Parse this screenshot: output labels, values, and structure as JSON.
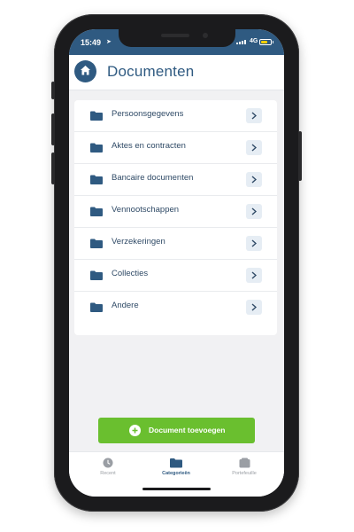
{
  "status_bar": {
    "time": "15:49",
    "location_glyph": "➤",
    "network": "4G"
  },
  "header": {
    "title": "Documenten"
  },
  "categories": [
    {
      "label": "Persoonsgegevens"
    },
    {
      "label": "Aktes en contracten"
    },
    {
      "label": "Bancaire documenten"
    },
    {
      "label": "Vennootschappen"
    },
    {
      "label": "Verzekeringen"
    },
    {
      "label": "Collecties"
    },
    {
      "label": "Andere"
    }
  ],
  "add_button": {
    "label": "Document toevoegen"
  },
  "tabs": [
    {
      "label": "Recent",
      "icon": "clock-icon",
      "active": false
    },
    {
      "label": "Categorieën",
      "icon": "folder-icon",
      "active": true
    },
    {
      "label": "Portefeuille",
      "icon": "wallet-icon",
      "active": false
    }
  ],
  "colors": {
    "primary": "#2f5a81",
    "accent_green": "#6abf2f",
    "background": "#f1f1f3",
    "chevron_bg": "#e6edf4"
  }
}
